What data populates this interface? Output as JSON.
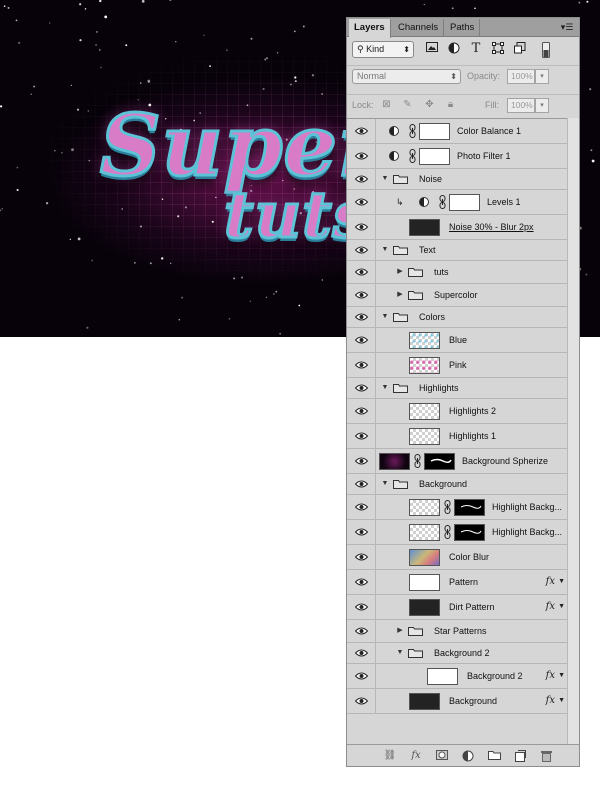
{
  "artwork": {
    "line1": "Superc",
    "line2": "tuts"
  },
  "panel": {
    "tabs": [
      "Layers",
      "Channels",
      "Paths"
    ],
    "menu_icon": "panel-menu-icon",
    "filter": {
      "kind_label": "Kind",
      "icons": [
        "image-filter-icon",
        "adjustment-filter-icon",
        "type-filter-icon",
        "shape-filter-icon",
        "smart-object-filter-icon",
        "filter-toggle-icon"
      ]
    },
    "blend_mode": "Normal",
    "opacity_label": "Opacity:",
    "opacity_value": "100%",
    "lock_label": "Lock:",
    "fill_label": "Fill:",
    "fill_value": "100%",
    "lock_icons": [
      "lock-transparent-pixels-icon",
      "lock-image-pixels-icon",
      "lock-position-icon",
      "lock-all-icon"
    ],
    "footer_icons": [
      "link-layers-icon",
      "add-layer-style-icon",
      "add-mask-icon",
      "new-adjustment-layer-icon",
      "new-group-icon",
      "new-layer-icon",
      "delete-layer-icon"
    ]
  },
  "layers": [
    {
      "name": "Color Balance 1",
      "type": "adjustment"
    },
    {
      "name": "Photo Filter 1",
      "type": "adjustment"
    },
    {
      "name": "Noise",
      "type": "group",
      "expanded": true
    },
    {
      "name": "Levels 1",
      "type": "adjustment-clipped"
    },
    {
      "name": "Noise 30% - Blur 2px",
      "type": "pixel"
    },
    {
      "name": "Text",
      "type": "group",
      "expanded": true
    },
    {
      "name": "tuts",
      "type": "group",
      "expanded": false
    },
    {
      "name": "Supercolor",
      "type": "group",
      "expanded": false
    },
    {
      "name": "Colors",
      "type": "group",
      "expanded": true
    },
    {
      "name": "Blue",
      "type": "pixel"
    },
    {
      "name": "Pink",
      "type": "pixel"
    },
    {
      "name": "Highlights",
      "type": "group",
      "expanded": true
    },
    {
      "name": "Highlights 2",
      "type": "pixel"
    },
    {
      "name": "Highlights 1",
      "type": "pixel"
    },
    {
      "name": "Background Spherize",
      "type": "masked"
    },
    {
      "name": "Background",
      "type": "group",
      "expanded": true
    },
    {
      "name": "Highlight Backg...",
      "type": "masked"
    },
    {
      "name": "Highlight Backg...",
      "type": "masked"
    },
    {
      "name": "Color Blur",
      "type": "pixel"
    },
    {
      "name": "Pattern",
      "type": "pixel",
      "fx": true
    },
    {
      "name": "Dirt Pattern",
      "type": "pixel",
      "fx": true
    },
    {
      "name": "Star Patterns",
      "type": "group",
      "expanded": false
    },
    {
      "name": "Background 2",
      "type": "group",
      "expanded": true
    },
    {
      "name": "Background 2",
      "type": "pixel",
      "fx": true
    },
    {
      "name": "Background",
      "type": "pixel",
      "fx": true
    }
  ],
  "fx_label": "fx"
}
